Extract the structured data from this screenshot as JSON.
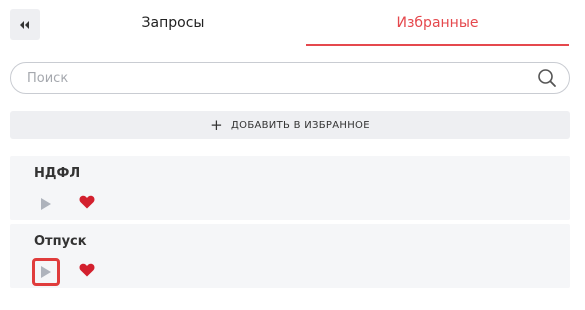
{
  "tabs": {
    "requests_label": "Запросы",
    "favorites_label": "Избранные",
    "active": "favorites"
  },
  "collapse_icon": "double-chevron-left-icon",
  "search": {
    "placeholder": "Поиск",
    "value": "",
    "icon": "search-icon"
  },
  "add_favorite": {
    "label": "ДОБАВИТЬ В ИЗБРАННОЕ",
    "icon": "plus-icon"
  },
  "favorites": [
    {
      "title": "НДФЛ",
      "play_icon": "play-icon",
      "favorite_icon": "heart-icon",
      "favorited": true
    },
    {
      "title": "Отпуск",
      "play_icon": "play-icon",
      "favorite_icon": "heart-icon",
      "favorited": true
    }
  ],
  "colors": {
    "accent": "#e5484d",
    "heart": "#d3202e",
    "play": "#aeb3bc",
    "highlight_border": "#e03c3c",
    "button_bg": "#eeeff2",
    "card_bg": "#f5f6f8"
  }
}
